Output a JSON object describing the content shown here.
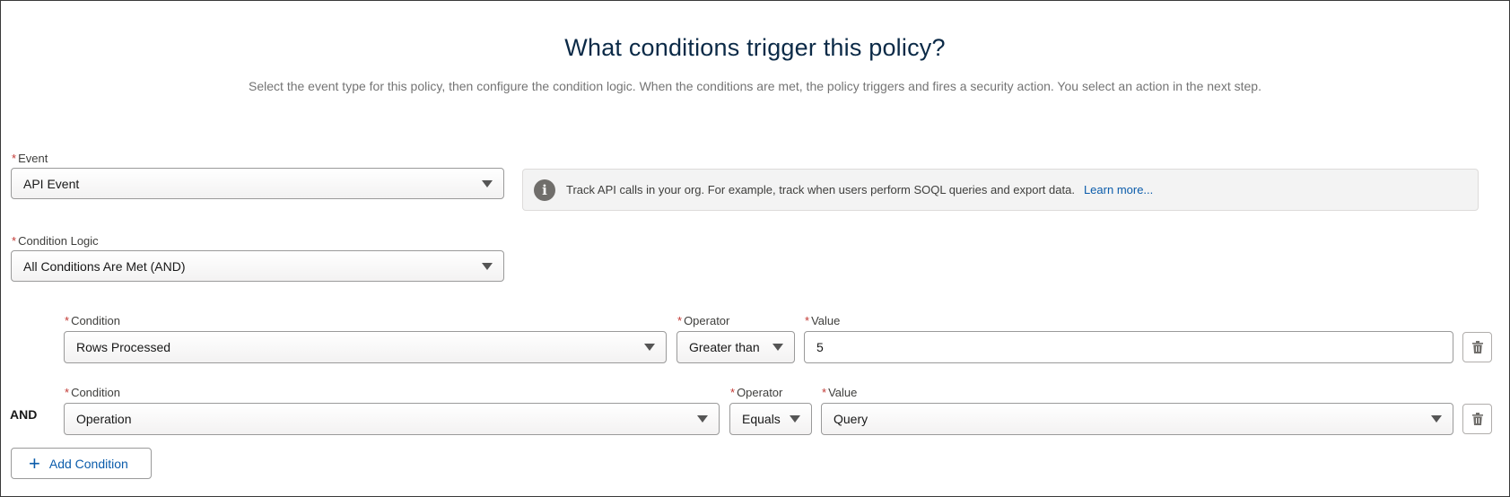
{
  "header": {
    "title": "What conditions trigger this policy?",
    "subtitle": "Select the event type for this policy, then configure the condition logic. When the conditions are met, the policy triggers and fires a security action. You select an action in the next step."
  },
  "required_marker": "*",
  "event": {
    "label": "Event",
    "value": "API Event"
  },
  "info": {
    "icon": "info-icon",
    "text": "Track API calls in your org. For example, track when users perform SOQL queries and export data.",
    "link": "Learn more..."
  },
  "condition_logic": {
    "label": "Condition Logic",
    "value": "All Conditions Are Met (AND)"
  },
  "conditions": [
    {
      "condition_label": "Condition",
      "condition_value": "Rows Processed",
      "operator_label": "Operator",
      "operator_value": "Greater than",
      "value_label": "Value",
      "value": "5"
    },
    {
      "connector": "AND",
      "condition_label": "Condition",
      "condition_value": "Operation",
      "operator_label": "Operator",
      "operator_value": "Equals",
      "value_label": "Value",
      "value": "Query"
    }
  ],
  "add_condition": {
    "label": "Add Condition",
    "icon": "plus-icon"
  },
  "colors": {
    "title": "#0b2a47",
    "link": "#0b5cab",
    "required": "#c23934"
  }
}
